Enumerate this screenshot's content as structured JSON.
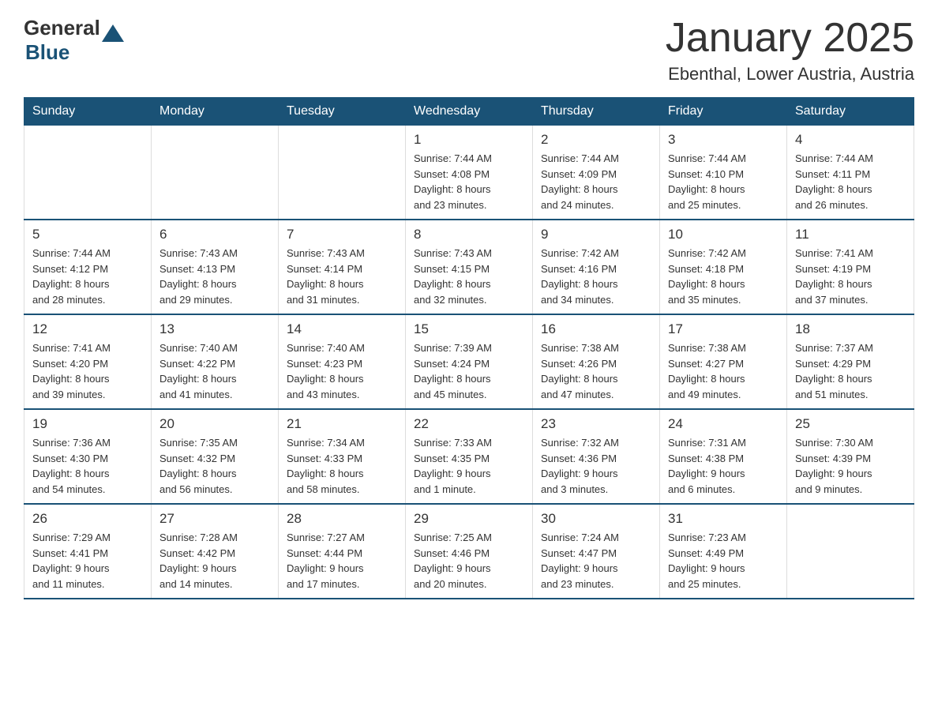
{
  "logo": {
    "general": "General",
    "blue": "Blue"
  },
  "header": {
    "title": "January 2025",
    "subtitle": "Ebenthal, Lower Austria, Austria"
  },
  "weekdays": [
    "Sunday",
    "Monday",
    "Tuesday",
    "Wednesday",
    "Thursday",
    "Friday",
    "Saturday"
  ],
  "weeks": [
    [
      {
        "day": "",
        "info": ""
      },
      {
        "day": "",
        "info": ""
      },
      {
        "day": "",
        "info": ""
      },
      {
        "day": "1",
        "info": "Sunrise: 7:44 AM\nSunset: 4:08 PM\nDaylight: 8 hours\nand 23 minutes."
      },
      {
        "day": "2",
        "info": "Sunrise: 7:44 AM\nSunset: 4:09 PM\nDaylight: 8 hours\nand 24 minutes."
      },
      {
        "day": "3",
        "info": "Sunrise: 7:44 AM\nSunset: 4:10 PM\nDaylight: 8 hours\nand 25 minutes."
      },
      {
        "day": "4",
        "info": "Sunrise: 7:44 AM\nSunset: 4:11 PM\nDaylight: 8 hours\nand 26 minutes."
      }
    ],
    [
      {
        "day": "5",
        "info": "Sunrise: 7:44 AM\nSunset: 4:12 PM\nDaylight: 8 hours\nand 28 minutes."
      },
      {
        "day": "6",
        "info": "Sunrise: 7:43 AM\nSunset: 4:13 PM\nDaylight: 8 hours\nand 29 minutes."
      },
      {
        "day": "7",
        "info": "Sunrise: 7:43 AM\nSunset: 4:14 PM\nDaylight: 8 hours\nand 31 minutes."
      },
      {
        "day": "8",
        "info": "Sunrise: 7:43 AM\nSunset: 4:15 PM\nDaylight: 8 hours\nand 32 minutes."
      },
      {
        "day": "9",
        "info": "Sunrise: 7:42 AM\nSunset: 4:16 PM\nDaylight: 8 hours\nand 34 minutes."
      },
      {
        "day": "10",
        "info": "Sunrise: 7:42 AM\nSunset: 4:18 PM\nDaylight: 8 hours\nand 35 minutes."
      },
      {
        "day": "11",
        "info": "Sunrise: 7:41 AM\nSunset: 4:19 PM\nDaylight: 8 hours\nand 37 minutes."
      }
    ],
    [
      {
        "day": "12",
        "info": "Sunrise: 7:41 AM\nSunset: 4:20 PM\nDaylight: 8 hours\nand 39 minutes."
      },
      {
        "day": "13",
        "info": "Sunrise: 7:40 AM\nSunset: 4:22 PM\nDaylight: 8 hours\nand 41 minutes."
      },
      {
        "day": "14",
        "info": "Sunrise: 7:40 AM\nSunset: 4:23 PM\nDaylight: 8 hours\nand 43 minutes."
      },
      {
        "day": "15",
        "info": "Sunrise: 7:39 AM\nSunset: 4:24 PM\nDaylight: 8 hours\nand 45 minutes."
      },
      {
        "day": "16",
        "info": "Sunrise: 7:38 AM\nSunset: 4:26 PM\nDaylight: 8 hours\nand 47 minutes."
      },
      {
        "day": "17",
        "info": "Sunrise: 7:38 AM\nSunset: 4:27 PM\nDaylight: 8 hours\nand 49 minutes."
      },
      {
        "day": "18",
        "info": "Sunrise: 7:37 AM\nSunset: 4:29 PM\nDaylight: 8 hours\nand 51 minutes."
      }
    ],
    [
      {
        "day": "19",
        "info": "Sunrise: 7:36 AM\nSunset: 4:30 PM\nDaylight: 8 hours\nand 54 minutes."
      },
      {
        "day": "20",
        "info": "Sunrise: 7:35 AM\nSunset: 4:32 PM\nDaylight: 8 hours\nand 56 minutes."
      },
      {
        "day": "21",
        "info": "Sunrise: 7:34 AM\nSunset: 4:33 PM\nDaylight: 8 hours\nand 58 minutes."
      },
      {
        "day": "22",
        "info": "Sunrise: 7:33 AM\nSunset: 4:35 PM\nDaylight: 9 hours\nand 1 minute."
      },
      {
        "day": "23",
        "info": "Sunrise: 7:32 AM\nSunset: 4:36 PM\nDaylight: 9 hours\nand 3 minutes."
      },
      {
        "day": "24",
        "info": "Sunrise: 7:31 AM\nSunset: 4:38 PM\nDaylight: 9 hours\nand 6 minutes."
      },
      {
        "day": "25",
        "info": "Sunrise: 7:30 AM\nSunset: 4:39 PM\nDaylight: 9 hours\nand 9 minutes."
      }
    ],
    [
      {
        "day": "26",
        "info": "Sunrise: 7:29 AM\nSunset: 4:41 PM\nDaylight: 9 hours\nand 11 minutes."
      },
      {
        "day": "27",
        "info": "Sunrise: 7:28 AM\nSunset: 4:42 PM\nDaylight: 9 hours\nand 14 minutes."
      },
      {
        "day": "28",
        "info": "Sunrise: 7:27 AM\nSunset: 4:44 PM\nDaylight: 9 hours\nand 17 minutes."
      },
      {
        "day": "29",
        "info": "Sunrise: 7:25 AM\nSunset: 4:46 PM\nDaylight: 9 hours\nand 20 minutes."
      },
      {
        "day": "30",
        "info": "Sunrise: 7:24 AM\nSunset: 4:47 PM\nDaylight: 9 hours\nand 23 minutes."
      },
      {
        "day": "31",
        "info": "Sunrise: 7:23 AM\nSunset: 4:49 PM\nDaylight: 9 hours\nand 25 minutes."
      },
      {
        "day": "",
        "info": ""
      }
    ]
  ]
}
